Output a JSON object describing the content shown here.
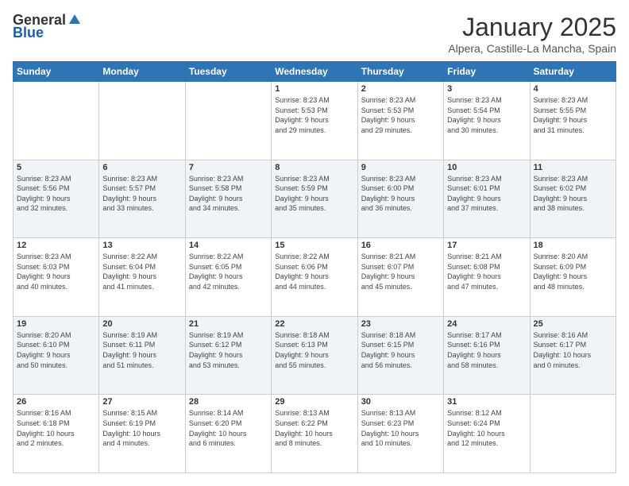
{
  "logo": {
    "general": "General",
    "blue": "Blue"
  },
  "header": {
    "month": "January 2025",
    "location": "Alpera, Castille-La Mancha, Spain"
  },
  "days": [
    "Sunday",
    "Monday",
    "Tuesday",
    "Wednesday",
    "Thursday",
    "Friday",
    "Saturday"
  ],
  "weeks": [
    [
      {
        "day": "",
        "content": ""
      },
      {
        "day": "",
        "content": ""
      },
      {
        "day": "",
        "content": ""
      },
      {
        "day": "1",
        "content": "Sunrise: 8:23 AM\nSunset: 5:53 PM\nDaylight: 9 hours\nand 29 minutes."
      },
      {
        "day": "2",
        "content": "Sunrise: 8:23 AM\nSunset: 5:53 PM\nDaylight: 9 hours\nand 29 minutes."
      },
      {
        "day": "3",
        "content": "Sunrise: 8:23 AM\nSunset: 5:54 PM\nDaylight: 9 hours\nand 30 minutes."
      },
      {
        "day": "4",
        "content": "Sunrise: 8:23 AM\nSunset: 5:55 PM\nDaylight: 9 hours\nand 31 minutes."
      }
    ],
    [
      {
        "day": "5",
        "content": "Sunrise: 8:23 AM\nSunset: 5:56 PM\nDaylight: 9 hours\nand 32 minutes."
      },
      {
        "day": "6",
        "content": "Sunrise: 8:23 AM\nSunset: 5:57 PM\nDaylight: 9 hours\nand 33 minutes."
      },
      {
        "day": "7",
        "content": "Sunrise: 8:23 AM\nSunset: 5:58 PM\nDaylight: 9 hours\nand 34 minutes."
      },
      {
        "day": "8",
        "content": "Sunrise: 8:23 AM\nSunset: 5:59 PM\nDaylight: 9 hours\nand 35 minutes."
      },
      {
        "day": "9",
        "content": "Sunrise: 8:23 AM\nSunset: 6:00 PM\nDaylight: 9 hours\nand 36 minutes."
      },
      {
        "day": "10",
        "content": "Sunrise: 8:23 AM\nSunset: 6:01 PM\nDaylight: 9 hours\nand 37 minutes."
      },
      {
        "day": "11",
        "content": "Sunrise: 8:23 AM\nSunset: 6:02 PM\nDaylight: 9 hours\nand 38 minutes."
      }
    ],
    [
      {
        "day": "12",
        "content": "Sunrise: 8:23 AM\nSunset: 6:03 PM\nDaylight: 9 hours\nand 40 minutes."
      },
      {
        "day": "13",
        "content": "Sunrise: 8:22 AM\nSunset: 6:04 PM\nDaylight: 9 hours\nand 41 minutes."
      },
      {
        "day": "14",
        "content": "Sunrise: 8:22 AM\nSunset: 6:05 PM\nDaylight: 9 hours\nand 42 minutes."
      },
      {
        "day": "15",
        "content": "Sunrise: 8:22 AM\nSunset: 6:06 PM\nDaylight: 9 hours\nand 44 minutes."
      },
      {
        "day": "16",
        "content": "Sunrise: 8:21 AM\nSunset: 6:07 PM\nDaylight: 9 hours\nand 45 minutes."
      },
      {
        "day": "17",
        "content": "Sunrise: 8:21 AM\nSunset: 6:08 PM\nDaylight: 9 hours\nand 47 minutes."
      },
      {
        "day": "18",
        "content": "Sunrise: 8:20 AM\nSunset: 6:09 PM\nDaylight: 9 hours\nand 48 minutes."
      }
    ],
    [
      {
        "day": "19",
        "content": "Sunrise: 8:20 AM\nSunset: 6:10 PM\nDaylight: 9 hours\nand 50 minutes."
      },
      {
        "day": "20",
        "content": "Sunrise: 8:19 AM\nSunset: 6:11 PM\nDaylight: 9 hours\nand 51 minutes."
      },
      {
        "day": "21",
        "content": "Sunrise: 8:19 AM\nSunset: 6:12 PM\nDaylight: 9 hours\nand 53 minutes."
      },
      {
        "day": "22",
        "content": "Sunrise: 8:18 AM\nSunset: 6:13 PM\nDaylight: 9 hours\nand 55 minutes."
      },
      {
        "day": "23",
        "content": "Sunrise: 8:18 AM\nSunset: 6:15 PM\nDaylight: 9 hours\nand 56 minutes."
      },
      {
        "day": "24",
        "content": "Sunrise: 8:17 AM\nSunset: 6:16 PM\nDaylight: 9 hours\nand 58 minutes."
      },
      {
        "day": "25",
        "content": "Sunrise: 8:16 AM\nSunset: 6:17 PM\nDaylight: 10 hours\nand 0 minutes."
      }
    ],
    [
      {
        "day": "26",
        "content": "Sunrise: 8:16 AM\nSunset: 6:18 PM\nDaylight: 10 hours\nand 2 minutes."
      },
      {
        "day": "27",
        "content": "Sunrise: 8:15 AM\nSunset: 6:19 PM\nDaylight: 10 hours\nand 4 minutes."
      },
      {
        "day": "28",
        "content": "Sunrise: 8:14 AM\nSunset: 6:20 PM\nDaylight: 10 hours\nand 6 minutes."
      },
      {
        "day": "29",
        "content": "Sunrise: 8:13 AM\nSunset: 6:22 PM\nDaylight: 10 hours\nand 8 minutes."
      },
      {
        "day": "30",
        "content": "Sunrise: 8:13 AM\nSunset: 6:23 PM\nDaylight: 10 hours\nand 10 minutes."
      },
      {
        "day": "31",
        "content": "Sunrise: 8:12 AM\nSunset: 6:24 PM\nDaylight: 10 hours\nand 12 minutes."
      },
      {
        "day": "",
        "content": ""
      }
    ]
  ]
}
